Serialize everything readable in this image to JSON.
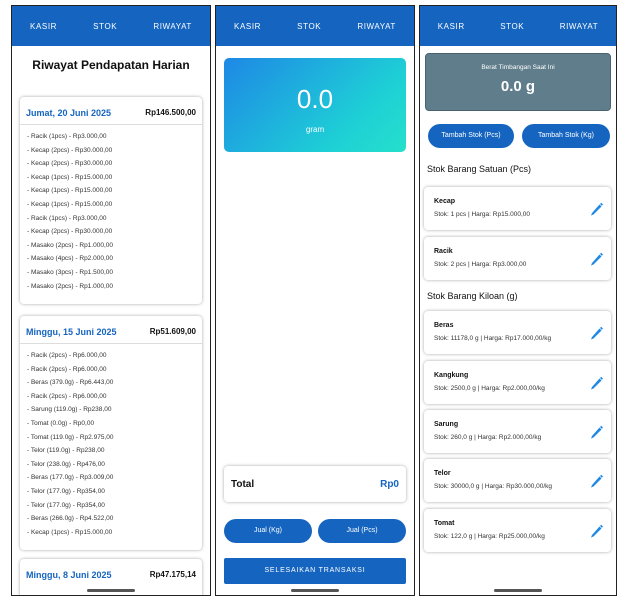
{
  "nav": {
    "tab_kasir": "KASIR",
    "tab_stok": "STOK",
    "tab_riwayat": "RIWAYAT"
  },
  "riwayat": {
    "title": "Riwayat Pendapatan Harian",
    "days": [
      {
        "date": "Jumat, 20 Juni 2025",
        "total": "Rp146.500,00",
        "items": [
          "- Racik (1pcs) - Rp3.000,00",
          "- Kecap (2pcs) - Rp30.000,00",
          "- Kecap (2pcs) - Rp30.000,00",
          "- Kecap (1pcs) - Rp15.000,00",
          "- Kecap (1pcs) - Rp15.000,00",
          "- Kecap (1pcs) - Rp15.000,00",
          "- Racik (1pcs) - Rp3.000,00",
          "- Kecap (2pcs) - Rp30.000,00",
          "- Masako (2pcs) - Rp1.000,00",
          "- Masako (4pcs) - Rp2.000,00",
          "- Masako (3pcs) - Rp1.500,00",
          "- Masako (2pcs) - Rp1.000,00"
        ]
      },
      {
        "date": "Minggu, 15 Juni 2025",
        "total": "Rp51.609,00",
        "items": [
          "- Racik (2pcs) - Rp6.000,00",
          "- Racik (2pcs) - Rp6.000,00",
          "- Beras (379.0g) - Rp6.443,00",
          "- Racik (2pcs) - Rp6.000,00",
          "- Sarung (119.0g) - Rp238,00",
          "- Tomat (0.0g) - Rp0,00",
          "- Tomat (119.0g) - Rp2.975,00",
          "- Telor (119.0g) - Rp238,00",
          "- Telor (238.0g) - Rp476,00",
          "- Beras (177.0g) - Rp3.009,00",
          "- Telor (177.0g) - Rp354,00",
          "- Telor (177.0g) - Rp354,00",
          "- Beras (266.0g) - Rp4.522,00",
          "- Kecap (1pcs) - Rp15.000,00"
        ]
      },
      {
        "date": "Minggu, 8 Juni 2025",
        "total": "Rp47.175,14",
        "items": []
      }
    ]
  },
  "kasir": {
    "scale_value": "0.0",
    "scale_unit": "gram",
    "total_label": "Total",
    "total_value": "Rp0",
    "btn_jual_kg": "Jual (Kg)",
    "btn_jual_pcs": "Jual (Pcs)",
    "btn_finish": "SELESAIKAN TRANSAKSI"
  },
  "stok": {
    "weigh_label": "Berat Timbangan Saat Ini",
    "weigh_value": "0.0 g",
    "btn_add_pcs": "Tambah Stok (Pcs)",
    "btn_add_kg": "Tambah Stok (Kg)",
    "section_pcs": "Stok Barang Satuan (Pcs)",
    "section_kg": "Stok Barang Kiloan (g)",
    "pcs_items": [
      {
        "name": "Kecap",
        "info": "Stok: 1 pcs | Harga: Rp15.000,00"
      },
      {
        "name": "Racik",
        "info": "Stok: 2 pcs | Harga: Rp3.000,00"
      }
    ],
    "kg_items": [
      {
        "name": "Beras",
        "info": "Stok: 11178,0 g | Harga: Rp17.000,00/kg"
      },
      {
        "name": "Kangkung",
        "info": "Stok: 2500,0 g | Harga: Rp2.000,00/kg"
      },
      {
        "name": "Sarung",
        "info": "Stok: 260,0 g | Harga: Rp2.000,00/kg"
      },
      {
        "name": "Telor",
        "info": "Stok: 30000,0 g | Harga: Rp30.000,00/kg"
      },
      {
        "name": "Tomat",
        "info": "Stok: 122,0 g | Harga: Rp25.000,00/kg"
      }
    ]
  },
  "colors": {
    "primary": "#1565c0",
    "weigh_box": "#607d8b",
    "gradient_start": "#1e88e5",
    "gradient_end": "#25e0cb"
  }
}
